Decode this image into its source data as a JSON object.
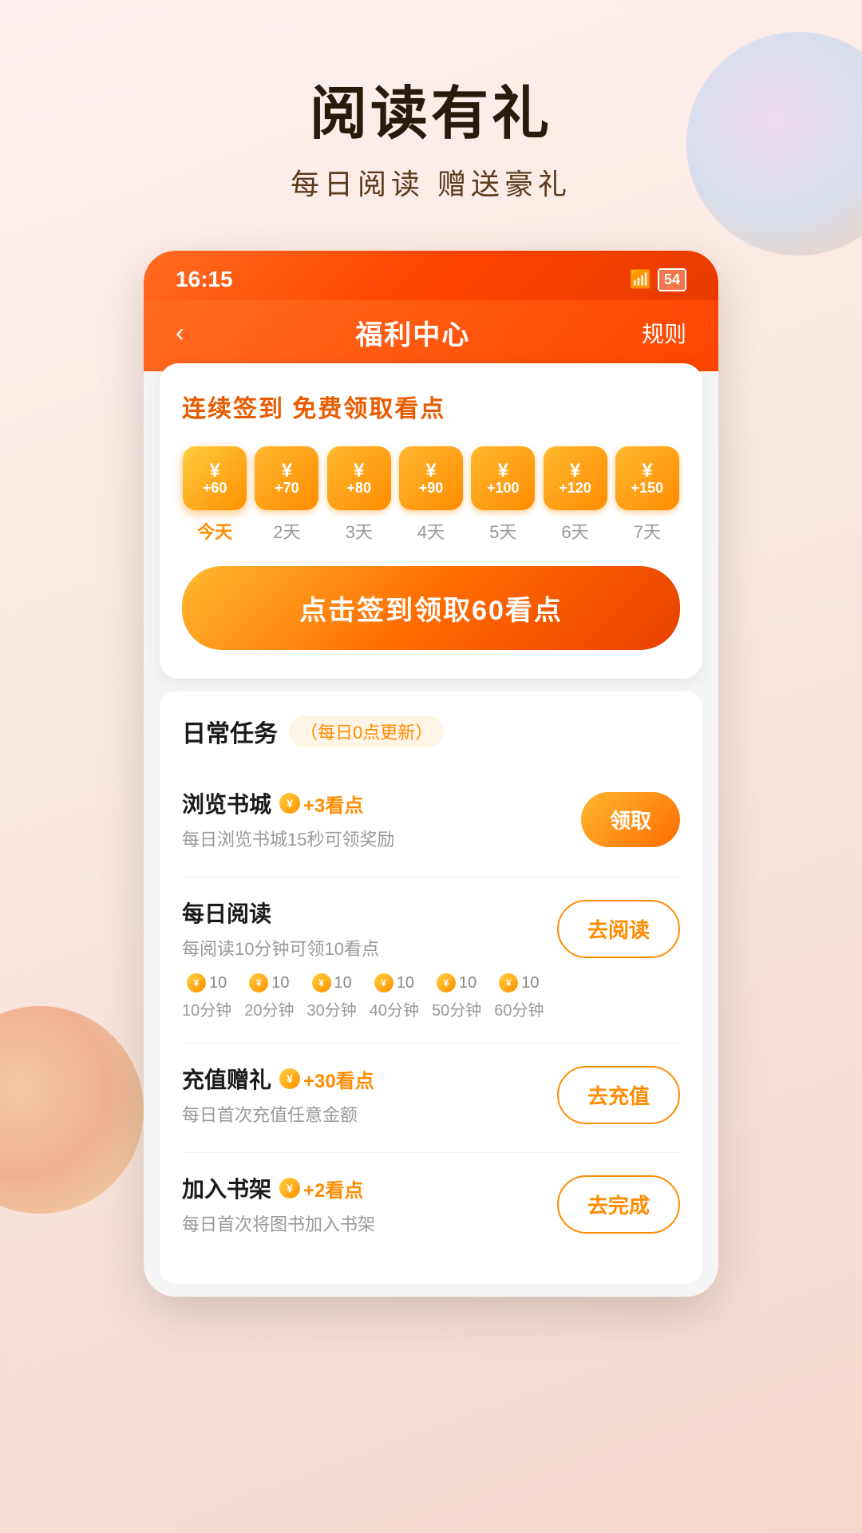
{
  "hero": {
    "title": "阅读有礼",
    "subtitle": "每日阅读  赠送豪礼"
  },
  "status_bar": {
    "time": "16:15",
    "battery": "54",
    "wifi_label": "WiFi"
  },
  "nav": {
    "back_icon": "‹",
    "title": "福利中心",
    "rules_label": "规则"
  },
  "signin": {
    "title": "连续签到 免费领取看点",
    "days": [
      {
        "amount": "+60",
        "label": "今天",
        "is_today": true
      },
      {
        "amount": "+70",
        "label": "2天",
        "is_today": false
      },
      {
        "amount": "+80",
        "label": "3天",
        "is_today": false
      },
      {
        "amount": "+90",
        "label": "4天",
        "is_today": false
      },
      {
        "amount": "+100",
        "label": "5天",
        "is_today": false
      },
      {
        "amount": "+120",
        "label": "6天",
        "is_today": false
      },
      {
        "amount": "+150",
        "label": "7天",
        "is_today": false
      }
    ],
    "btn_label": "点击签到领取60看点"
  },
  "tasks": {
    "section_title": "日常任务",
    "section_badge": "（每日0点更新）",
    "items": [
      {
        "name": "浏览书城",
        "reward_text": "+3看点",
        "desc": "每日浏览书城15秒可领奖励",
        "btn_label": "领取",
        "btn_type": "primary"
      },
      {
        "name": "每日阅读",
        "reward_text": "",
        "desc": "每阅读10分钟可领10看点",
        "btn_label": "去阅读",
        "btn_type": "outline",
        "progress": [
          {
            "amount": "10",
            "time": "10分钟"
          },
          {
            "amount": "10",
            "time": "20分钟"
          },
          {
            "amount": "10",
            "time": "30分钟"
          },
          {
            "amount": "10",
            "time": "40分钟"
          },
          {
            "amount": "10",
            "time": "50分钟"
          },
          {
            "amount": "10",
            "time": "60分钟"
          }
        ]
      },
      {
        "name": "充值赠礼",
        "reward_text": "+30看点",
        "desc": "每日首次充值任意金额",
        "btn_label": "去充值",
        "btn_type": "outline"
      },
      {
        "name": "加入书架",
        "reward_text": "+2看点",
        "desc": "每日首次将图书加入书架",
        "btn_label": "去完成",
        "btn_type": "complete"
      }
    ]
  }
}
